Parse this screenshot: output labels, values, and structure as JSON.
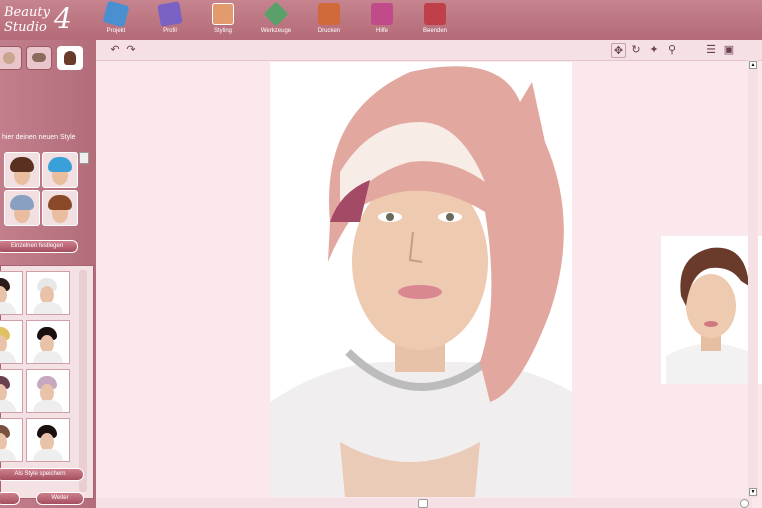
{
  "app": {
    "logo_line1": "Beauty",
    "logo_line2": "Studio",
    "logo_number": "4"
  },
  "toolbar": [
    {
      "label": "Projekt",
      "icon": "projekt-icon",
      "color": "#4a8fd0"
    },
    {
      "label": "Profil",
      "icon": "profil-icon",
      "color": "#7a62c4"
    },
    {
      "label": "Styling",
      "icon": "styling-icon",
      "color": "#e39a6c",
      "active": true
    },
    {
      "label": "Werkzeuge",
      "icon": "werkzeuge-icon",
      "color": "#5aa06a"
    },
    {
      "label": "Drucken",
      "icon": "drucken-icon",
      "color": "#d06a3a"
    },
    {
      "label": "Hilfe",
      "icon": "hilfe-icon",
      "color": "#c04a8a"
    },
    {
      "label": "Beenden",
      "icon": "beenden-icon",
      "color": "#c0404a"
    }
  ],
  "left_panel": {
    "style_label": "hier deinen neuen Style",
    "apply_button": "Einzelnen festlegen",
    "save_button": "Als Style speichern",
    "next_button": "Weiter"
  },
  "colors": {
    "accent": "#b46a77",
    "panel": "#c27f8b",
    "canvas": "#fbe8ec"
  }
}
